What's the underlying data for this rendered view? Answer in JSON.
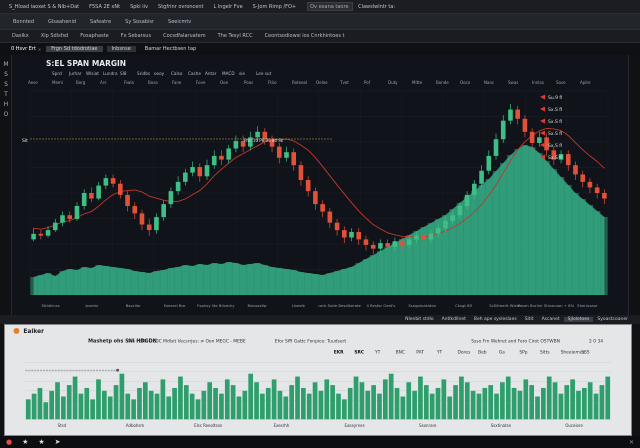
{
  "title_bar": {
    "tabs": [
      "S_Hload iaoxet S & Nib+Dat",
      "F5SA 2E xNt",
      "Spki iiv",
      "Stgfrinr ovroncent",
      "L lngelr Fve",
      "S-Jom Rimp /FO+"
    ],
    "search_placeholder": "Ov exana taore",
    "right_items": [
      "Clawslwlntr ta:"
    ]
  },
  "menu_bar": {
    "items": [
      "Bonnted",
      "Glsaahenid",
      "Safeatre",
      "Sy Sosabisr",
      "Seeicmtv"
    ]
  },
  "toolbar": {
    "items": [
      "Daslkx",
      "Xip Sdlsfsd",
      "Fosaphaste",
      "Fx Sebarsus",
      "Cocsdfalaruatem",
      "The Tesyl RCC",
      "Ceontsodiowsi ios Cnrkhintoes t"
    ]
  },
  "chart_tabs": {
    "items": [
      "0 Hsvr Ert",
      "Frgn  Sd tdodrotiae",
      "Inbsnse",
      "Bamar Hectbsen tap"
    ]
  },
  "left_labels": [
    "M",
    "S",
    "S",
    "T",
    "H",
    "O"
  ],
  "main_chart": {
    "title": "S:EL SPAN MARGIN",
    "indicators": [
      "Sprcl",
      "Jurhar",
      "Wlsiat",
      "Lundra",
      "Sl8",
      "Sridbs",
      "oooy",
      "Calso",
      "Cashe",
      "Antar",
      "MACD",
      "sie",
      "Lee sut"
    ],
    "header_labels": [
      "Aese",
      "Memi",
      "Borg",
      "Ars",
      "Fiwla",
      "Bosa",
      "Fane",
      "Fove",
      "Ooe",
      "Poos",
      "Ftiio",
      "Roteeal",
      "Oelee",
      "Tvet",
      "Pof",
      "Duty",
      "Mitte",
      "Bonde",
      "Ooco",
      "Nanc",
      "Swas",
      "Innlas",
      "Sase",
      "Apite"
    ],
    "legend": [
      "Su.9 fl",
      "Sx.S fl",
      "Sx.S fl",
      "Sx.S fl",
      "Sx.S fl",
      "Sx.S fl"
    ],
    "annotation": "Pm: 10 P8.95 84 Sk",
    "price_label": "Slt",
    "x_axis_labels": [
      "Stlidhinss",
      "Jovelar",
      "Bsocilar",
      "Exeorel Bre",
      "Fxphsy lite Bilvedry",
      "Beouasllw",
      "Llxesfe",
      "rock Sede Besdlkerate",
      "4 Resfor Geat's",
      "Ssngoinakidon",
      "Cksgt 8fl",
      "ScSilteerlt Wiele",
      "Fasen Burlinr Stivacoon + 8%",
      "Sherlusaor"
    ],
    "colors": {
      "up": "#3fbf86",
      "down": "#e0523a",
      "ma": "#c0392b",
      "volume": "#34a882"
    },
    "chart_data": {
      "type": "candlestick",
      "title": "S:EL SPAN MARGIN",
      "candles": [
        [
          60,
          66,
          58,
          72
        ],
        [
          66,
          64,
          60,
          70
        ],
        [
          64,
          70,
          62,
          74
        ],
        [
          70,
          78,
          68,
          82
        ],
        [
          78,
          86,
          74,
          90
        ],
        [
          86,
          82,
          78,
          90
        ],
        [
          82,
          96,
          80,
          100
        ],
        [
          96,
          110,
          92,
          114
        ],
        [
          110,
          104,
          100,
          116
        ],
        [
          104,
          118,
          102,
          122
        ],
        [
          118,
          126,
          114,
          130
        ],
        [
          126,
          120,
          116,
          130
        ],
        [
          120,
          108,
          104,
          124
        ],
        [
          108,
          96,
          90,
          112
        ],
        [
          96,
          88,
          82,
          100
        ],
        [
          88,
          76,
          70,
          92
        ],
        [
          76,
          70,
          64,
          82
        ],
        [
          70,
          84,
          66,
          88
        ],
        [
          84,
          98,
          80,
          102
        ],
        [
          98,
          112,
          94,
          116
        ],
        [
          112,
          122,
          108,
          128
        ],
        [
          122,
          132,
          118,
          136
        ],
        [
          132,
          138,
          128,
          144
        ],
        [
          138,
          128,
          122,
          142
        ],
        [
          128,
          140,
          124,
          146
        ],
        [
          140,
          150,
          136,
          156
        ],
        [
          150,
          146,
          140,
          156
        ],
        [
          146,
          158,
          142,
          162
        ],
        [
          158,
          166,
          154,
          172
        ],
        [
          166,
          160,
          154,
          172
        ],
        [
          160,
          170,
          156,
          176
        ],
        [
          170,
          176,
          166,
          182
        ],
        [
          176,
          168,
          162,
          180
        ],
        [
          168,
          160,
          154,
          172
        ],
        [
          160,
          148,
          142,
          164
        ],
        [
          148,
          154,
          144,
          160
        ],
        [
          154,
          140,
          134,
          158
        ],
        [
          140,
          124,
          118,
          144
        ],
        [
          124,
          112,
          106,
          128
        ],
        [
          112,
          98,
          92,
          116
        ],
        [
          98,
          90,
          84,
          102
        ],
        [
          90,
          78,
          72,
          94
        ],
        [
          78,
          70,
          64,
          82
        ],
        [
          70,
          62,
          56,
          74
        ],
        [
          62,
          68,
          58,
          72
        ],
        [
          68,
          60,
          54,
          72
        ],
        [
          60,
          54,
          48,
          64
        ],
        [
          54,
          50,
          44,
          58
        ],
        [
          50,
          56,
          46,
          60
        ],
        [
          56,
          52,
          46,
          60
        ],
        [
          52,
          58,
          48,
          62
        ],
        [
          58,
          54,
          48,
          62
        ],
        [
          54,
          60,
          50,
          64
        ],
        [
          60,
          64,
          56,
          68
        ],
        [
          64,
          60,
          54,
          68
        ],
        [
          60,
          66,
          56,
          70
        ],
        [
          66,
          72,
          62,
          76
        ],
        [
          72,
          80,
          68,
          84
        ],
        [
          80,
          86,
          76,
          90
        ],
        [
          86,
          96,
          82,
          100
        ],
        [
          96,
          108,
          92,
          112
        ],
        [
          108,
          120,
          104,
          124
        ],
        [
          120,
          134,
          116,
          140
        ],
        [
          134,
          150,
          130,
          156
        ],
        [
          150,
          168,
          146,
          174
        ],
        [
          168,
          188,
          164,
          194
        ],
        [
          188,
          200,
          184,
          206
        ],
        [
          200,
          190,
          184,
          204
        ],
        [
          190,
          176,
          170,
          194
        ],
        [
          176,
          164,
          158,
          180
        ],
        [
          164,
          170,
          160,
          176
        ],
        [
          170,
          156,
          150,
          174
        ],
        [
          156,
          146,
          140,
          160
        ],
        [
          146,
          152,
          142,
          156
        ],
        [
          152,
          140,
          134,
          156
        ],
        [
          140,
          130,
          124,
          144
        ],
        [
          130,
          122,
          116,
          134
        ],
        [
          122,
          116,
          110,
          126
        ],
        [
          116,
          110,
          104,
          120
        ],
        [
          110,
          104,
          98,
          114
        ]
      ],
      "volume": [
        18,
        20,
        22,
        19,
        24,
        26,
        25,
        28,
        27,
        30,
        29,
        28,
        27,
        26,
        24,
        23,
        22,
        24,
        25,
        27,
        28,
        30,
        29,
        31,
        30,
        32,
        31,
        33,
        32,
        30,
        31,
        32,
        30,
        28,
        27,
        26,
        25,
        23,
        22,
        21,
        20,
        22,
        24,
        26,
        28,
        32,
        36,
        40,
        44,
        48,
        52,
        56,
        60,
        64,
        68,
        72,
        76,
        80,
        86,
        92,
        98,
        104,
        110,
        116,
        124,
        132,
        140,
        146,
        150,
        148,
        142,
        134,
        126,
        118,
        110,
        102,
        96,
        90,
        84,
        78
      ],
      "ylim": [
        0,
        220
      ]
    }
  },
  "mid_toolbar": {
    "items": [
      "Nlenbit stdlo",
      "Antlkdllnet",
      "Beh ape sysleslaes",
      "Sitit",
      "Ascanet",
      "Sjloletoes",
      "Syoastcoaner"
    ],
    "active": "Sjloletoes"
  },
  "lower_panel": {
    "logo": "Eaiker",
    "title": "Mashetp ohs SNI HDGDN",
    "sub": "Pos  FSNS DEDC Mdlsit Vecsrrjes: ≠ Oon MEGC  -  MEBE",
    "sub2": "Efor SfR Gattc Fonpice: Tuudsert",
    "info": "Ssso  Frn Wehret and Fero Cirot OSTWBN",
    "info2": "2 0 34",
    "toolbar": [
      "EKR",
      "SRC",
      "YT",
      "BNC",
      "PAT",
      "YT",
      "Dores",
      "Beb",
      "Ga",
      "SPp",
      "Sitts",
      "Sheeiemus",
      "SSS"
    ],
    "x_axis_labels": [
      "Stsd",
      "Adbohsm",
      "Elsc Reeoltson",
      "Exesrhh",
      "Easeyrnes",
      "Ssonrare",
      "Ssxtinatse",
      "Ouceiore"
    ],
    "colors": {
      "bar": "#2e9e6c",
      "line": "#1d6b4a",
      "accent": "#e74c3c"
    },
    "chart_data": {
      "type": "bar",
      "values": [
        14,
        18,
        22,
        12,
        20,
        26,
        16,
        24,
        30,
        18,
        22,
        14,
        28,
        20,
        16,
        24,
        32,
        18,
        14,
        22,
        26,
        20,
        18,
        28,
        16,
        22,
        30,
        24,
        18,
        14,
        20,
        26,
        22,
        18,
        28,
        24,
        16,
        20,
        32,
        26,
        18,
        22,
        28,
        20,
        16,
        24,
        30,
        22,
        18,
        26,
        20,
        28,
        24,
        18,
        14,
        22,
        30,
        26,
        20,
        24,
        18,
        28,
        32,
        22,
        16,
        26,
        20,
        30,
        24,
        18,
        22,
        28,
        16,
        24,
        30,
        26,
        20,
        18,
        22,
        24,
        18,
        26,
        30,
        22,
        20,
        28,
        24,
        16,
        22,
        30,
        26,
        18,
        24,
        28,
        20,
        22,
        26,
        18,
        24,
        30
      ],
      "ylim": [
        0,
        40
      ]
    }
  },
  "bottom_bar": {
    "icons": [
      "record-icon",
      "star-icon",
      "star-icon",
      "arrow-icon"
    ],
    "close_label": "✕"
  }
}
